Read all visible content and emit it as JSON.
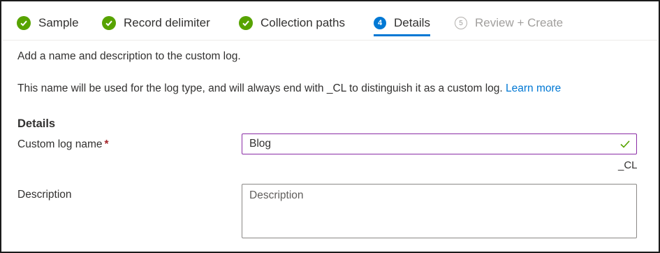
{
  "steps": [
    {
      "label": "Sample",
      "status": "completed"
    },
    {
      "label": "Record delimiter",
      "status": "completed"
    },
    {
      "label": "Collection paths",
      "status": "completed"
    },
    {
      "number": "4",
      "label": "Details",
      "status": "active"
    },
    {
      "number": "5",
      "label": "Review + Create",
      "status": "disabled"
    }
  ],
  "intro": "Add a name and description to the custom log.",
  "info": {
    "text": "This name will be used for the log type, and will always end with _CL to distinguish it as a custom log.",
    "link": "Learn more"
  },
  "section_title": "Details",
  "custom_log_name": {
    "label": "Custom log name",
    "required_marker": "*",
    "value": "Blog",
    "suffix": "_CL",
    "valid_icon": "checkmark-icon"
  },
  "description": {
    "label": "Description",
    "placeholder": "Description"
  },
  "colors": {
    "completed": "#57a300",
    "active": "#0078d4",
    "link": "#0078d4",
    "required": "#a4262c",
    "focus_border": "#8a2da5"
  }
}
